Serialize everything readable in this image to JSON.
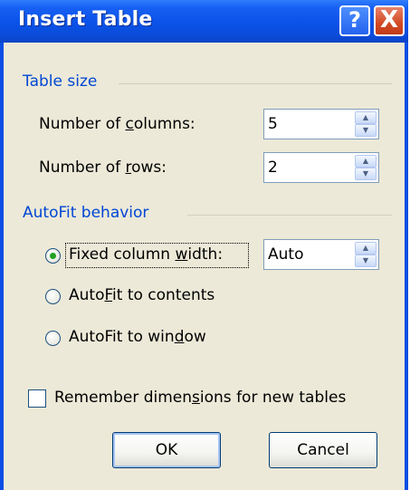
{
  "window": {
    "title": "Insert Table",
    "help_glyph": "?",
    "close_glyph": "X"
  },
  "table_size": {
    "heading": "Table size",
    "columns": {
      "label_pre": "Number of ",
      "label_u": "c",
      "label_post": "olumns:",
      "value": "5"
    },
    "rows": {
      "label_pre": "Number of ",
      "label_u": "r",
      "label_post": "ows:",
      "value": "2"
    }
  },
  "autofit": {
    "heading": "AutoFit behavior",
    "fixed": {
      "label_pre": "Fixed column ",
      "label_u": "w",
      "label_post": "idth:",
      "value": "Auto",
      "checked": true
    },
    "contents": {
      "label_pre": "Auto",
      "label_u": "F",
      "label_post": "it to contents",
      "checked": false
    },
    "window": {
      "label_pre": "AutoFit to win",
      "label_u": "d",
      "label_post": "ow",
      "checked": false
    }
  },
  "remember": {
    "label_pre": "Remember dimen",
    "label_u": "s",
    "label_post": "ions for new tables",
    "checked": false
  },
  "buttons": {
    "ok": "OK",
    "cancel": "Cancel"
  },
  "colors": {
    "titlebar": "#0a52e8",
    "group_heading": "#0046d5",
    "dialog_bg": "#ece9d8",
    "radio_dot": "#21a121"
  }
}
